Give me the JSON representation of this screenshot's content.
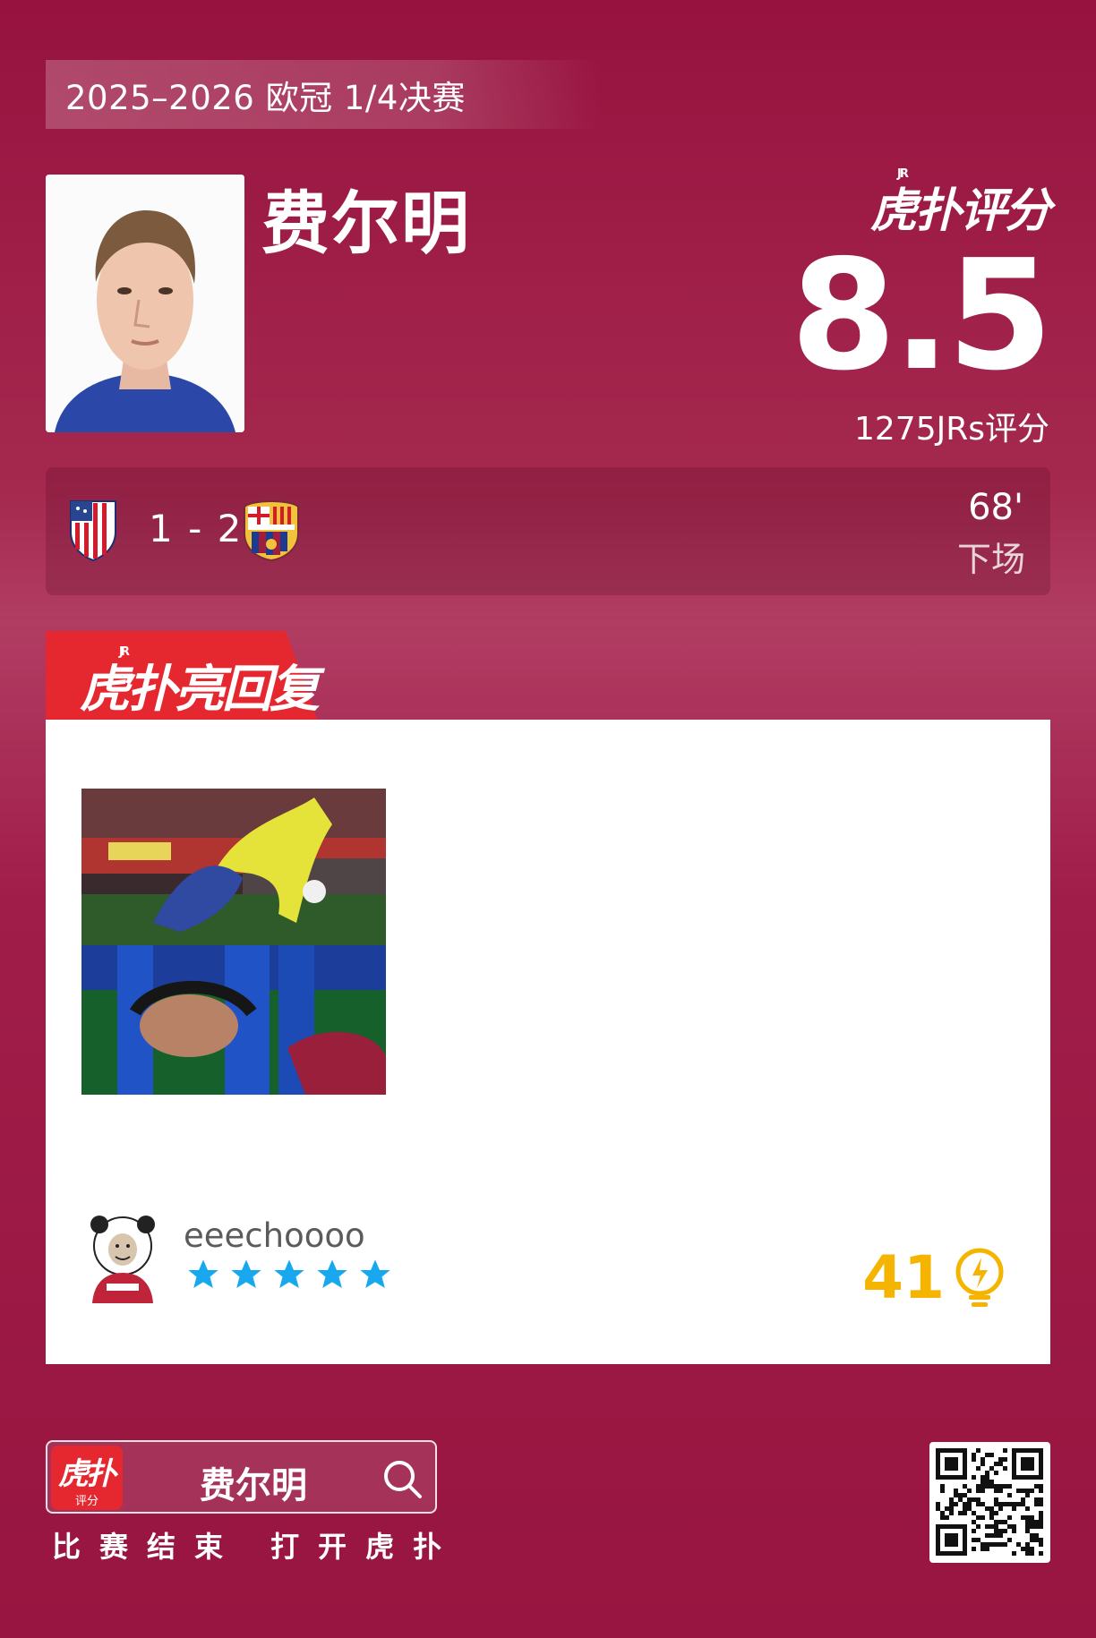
{
  "competition": "2025–2026 欧冠 1/4决赛",
  "player": {
    "name": "费尔明"
  },
  "rating": {
    "brand": "虎扑评分",
    "brand_jr": "JR",
    "score": "8.5",
    "count": "1275JRs评分"
  },
  "match": {
    "home_team_icon": "atletico-madrid-crest",
    "away_team_icon": "fc-barcelona-crest",
    "score": "1 - 2",
    "sub_minute": "68'",
    "sub_status": "下场"
  },
  "highlight": {
    "tab_label": "虎扑亮回复",
    "tab_jr": "JR",
    "tab_color": "#e5272f",
    "photo_icon": "match-photo",
    "comment": {
      "avatar_icon": "panda-meme-avatar",
      "username": "eeechoooo",
      "star_rating": 5,
      "star_color": "#18a8f0",
      "likes": "41",
      "likes_color": "#f5b400",
      "likes_icon": "lightbulb-icon"
    }
  },
  "footer": {
    "app_icon_title": "虎扑",
    "app_icon_sub": "评分",
    "search_query": "费尔明",
    "tagline": "比赛结束 打开虎扑",
    "qr_icon": "qr-code"
  }
}
